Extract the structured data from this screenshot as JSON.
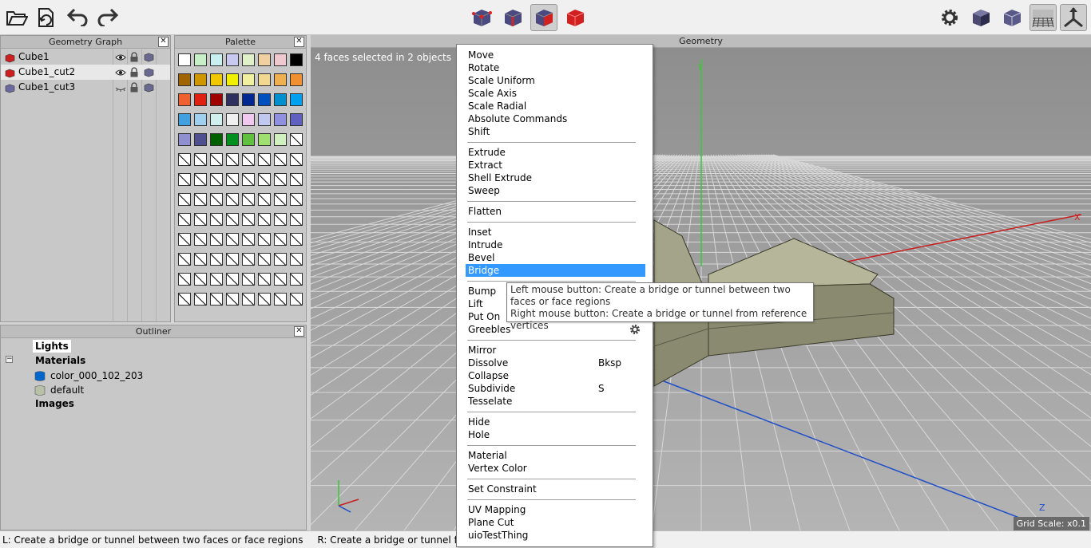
{
  "toolbar": {
    "left_icons": [
      "open-folder-icon",
      "import-icon",
      "undo-icon",
      "redo-icon"
    ],
    "center_icons": [
      "select-vertex-icon",
      "select-edge-icon",
      "select-face-icon",
      "select-object-icon"
    ],
    "right_icons": [
      "settings-gear-icon",
      "shaded-cube-icon",
      "wireframe-cube-icon",
      "ground-grid-icon",
      "axes-toggle-icon"
    ]
  },
  "geometry_graph": {
    "title": "Geometry Graph",
    "rows": [
      {
        "name": "Cube1",
        "color": "#cc2020",
        "visibility": "eye"
      },
      {
        "name": "Cube1_cut2",
        "color": "#cc2020",
        "visibility": "eye"
      },
      {
        "name": "Cube1_cut3",
        "color": "#6a6aa0",
        "visibility": "hidden"
      }
    ]
  },
  "palette": {
    "title": "Palette",
    "colors": [
      "#ffffff",
      "#c8f0c8",
      "#c8f0f0",
      "#c8c8f0",
      "#e0f0c8",
      "#f0d0a0",
      "#f0c8d0",
      "#000000",
      "#a06400",
      "#d09600",
      "#f0c800",
      "#f0f000",
      "#f0f0a0",
      "#f0d890",
      "#f0b050",
      "#f09030",
      "#f06030",
      "#e02010",
      "#a00000",
      "#303060",
      "#002890",
      "#0050c0",
      "#0090d0",
      "#00a0f0",
      "#40a0e0",
      "#a0d0f0",
      "#d0f0f0",
      "#f0f0f0",
      "#f0c8f0",
      "#c0c8f0",
      "#9090e0",
      "#6060c0",
      "#9090d0",
      "#505090",
      "#006000",
      "#009020",
      "#60c040",
      "#a0e070",
      "#d0f0c0"
    ]
  },
  "outliner": {
    "title": "Outliner",
    "lights": "Lights",
    "materials": "Materials",
    "material_items": [
      {
        "name": "color_000_102_203",
        "color": "#0066cb"
      },
      {
        "name": "default",
        "color": "#b8c0a8"
      }
    ],
    "images": "Images"
  },
  "viewport": {
    "title": "Geometry",
    "selection_info": "4 faces selected in 2 objects",
    "grid_scale": "Grid Scale: x0.1",
    "axis_labels": {
      "x": "X",
      "y": "Y",
      "z": "Z"
    }
  },
  "context_menu": {
    "groups": [
      [
        {
          "label": "Move"
        },
        {
          "label": "Rotate"
        },
        {
          "label": "Scale Uniform"
        },
        {
          "label": "Scale Axis"
        },
        {
          "label": "Scale Radial"
        },
        {
          "label": "Absolute Commands"
        },
        {
          "label": "Shift"
        }
      ],
      [
        {
          "label": "Extrude"
        },
        {
          "label": "Extract"
        },
        {
          "label": "Shell Extrude"
        },
        {
          "label": "Sweep"
        }
      ],
      [
        {
          "label": "Flatten"
        }
      ],
      [
        {
          "label": "Inset"
        },
        {
          "label": "Intrude"
        },
        {
          "label": "Bevel"
        },
        {
          "label": "Bridge",
          "highlighted": true
        }
      ],
      [
        {
          "label": "Bump"
        },
        {
          "label": "Lift"
        },
        {
          "label": "Put On"
        },
        {
          "label": "Greebles",
          "has_gear": true
        }
      ],
      [
        {
          "label": "Mirror"
        },
        {
          "label": "Dissolve",
          "shortcut": "Bksp"
        },
        {
          "label": "Collapse"
        },
        {
          "label": "Subdivide",
          "shortcut": "S"
        },
        {
          "label": "Tesselate"
        }
      ],
      [
        {
          "label": "Hide"
        },
        {
          "label": "Hole"
        }
      ],
      [
        {
          "label": "Material"
        },
        {
          "label": "Vertex Color"
        }
      ],
      [
        {
          "label": "Set Constraint"
        }
      ],
      [
        {
          "label": "UV Mapping"
        },
        {
          "label": "Plane Cut"
        },
        {
          "label": "uioTestThing"
        }
      ]
    ]
  },
  "tooltip": {
    "line1": "Left mouse button: Create a bridge or tunnel between two faces or face regions",
    "line2": "Right mouse button: Create a bridge or tunnel from reference vertices"
  },
  "status_bar": {
    "left": "L: Create a bridge or tunnel between two faces or face regions",
    "right": "R: Create a bridge or tunnel from reference vertices"
  }
}
